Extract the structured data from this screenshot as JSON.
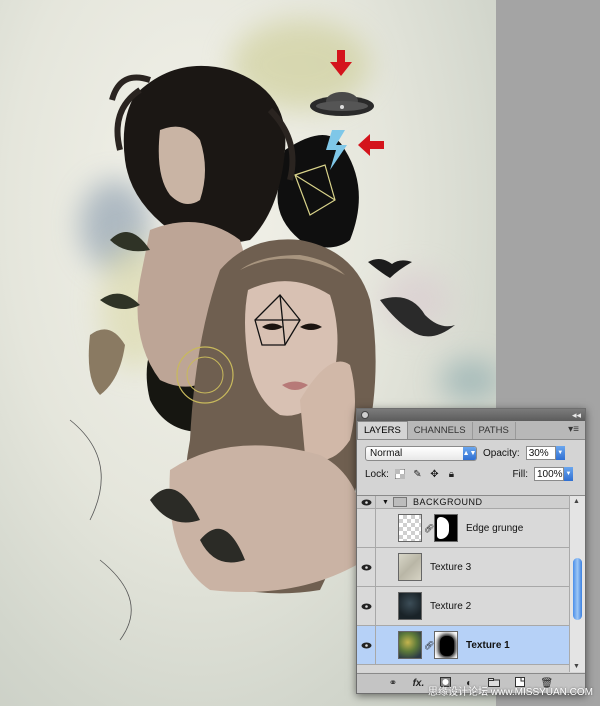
{
  "panel": {
    "collapse_glyph": "◂◂",
    "tabs": [
      {
        "label": "LAYERS",
        "active": true
      },
      {
        "label": "CHANNELS",
        "active": false
      },
      {
        "label": "PATHS",
        "active": false
      }
    ],
    "tab_menu_glyph": "▾≡",
    "blend_mode": "Normal",
    "opacity_label": "Opacity:",
    "opacity_value": "30%",
    "lock_label": "Lock:",
    "fill_label": "Fill:",
    "fill_value": "100%",
    "group": {
      "name": "BACKGROUND"
    },
    "layers": [
      {
        "name": "Edge grunge",
        "has_mask": true,
        "visible": false,
        "selected": false
      },
      {
        "name": "Texture 3",
        "has_mask": false,
        "visible": true,
        "selected": false
      },
      {
        "name": "Texture 2",
        "has_mask": false,
        "visible": true,
        "selected": false
      },
      {
        "name": "Texture 1",
        "has_mask": true,
        "visible": true,
        "selected": true
      }
    ],
    "bottom_icons": [
      "link-icon",
      "fx-icon",
      "add-mask-icon",
      "adjustment-icon",
      "new-group-icon",
      "new-layer-icon",
      "trash-icon"
    ],
    "fx_label": "fx."
  },
  "watermark": "思缘设计论坛 www.MISSYUAN.COM",
  "colors": {
    "selected_row": "#b6d1f7",
    "accent_blue": "#2f6fd2",
    "arrow_red": "#d4141c"
  }
}
